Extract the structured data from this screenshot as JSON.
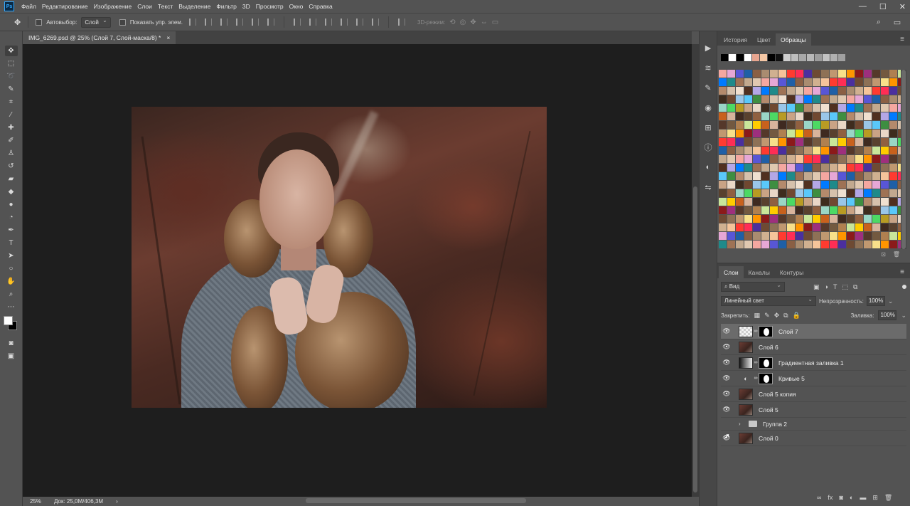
{
  "app": {
    "logo": "Ps"
  },
  "menu": [
    "Файл",
    "Редактирование",
    "Изображение",
    "Слои",
    "Текст",
    "Выделение",
    "Фильтр",
    "3D",
    "Просмотр",
    "Окно",
    "Справка"
  ],
  "window_controls": {
    "minimize": "—",
    "maximize": "☐",
    "close": "✕"
  },
  "options": {
    "autoselect_label": "Автовыбор:",
    "autoselect_value": "Слой",
    "show_controls_label": "Показать упр. элем.",
    "mode3d_label": "3D-режим:"
  },
  "document": {
    "tab_title": "IMG_6269.psd @ 25% (Слой 7, Слой-маска/8) *",
    "close": "×"
  },
  "status": {
    "zoom": "25%",
    "doc_size": "Док: 25,0M/406,3M"
  },
  "panels": {
    "top_tabs": [
      {
        "label": "История"
      },
      {
        "label": "Цвет"
      },
      {
        "label": "Образцы"
      }
    ],
    "active_top_tab": "Образцы",
    "layers_tabs": [
      {
        "label": "Слои"
      },
      {
        "label": "Каналы"
      },
      {
        "label": "Контуры"
      }
    ],
    "active_layers_tab": "Слои"
  },
  "layers_panel": {
    "filter_value": "⌕ Вид",
    "blend_mode": "Линейный свет",
    "opacity_label": "Непрозрачность:",
    "opacity_value": "100%",
    "lock_label": "Закрепить:",
    "fill_label": "Заливка:",
    "fill_value": "100%",
    "layers": [
      {
        "name": "Слой 7",
        "kind": "checker_mask",
        "visible": true,
        "selected": true
      },
      {
        "name": "Слой 6",
        "kind": "photo",
        "visible": true,
        "selected": false
      },
      {
        "name": "Градиентная заливка 1",
        "kind": "gradient_mask",
        "visible": true,
        "selected": false
      },
      {
        "name": "Кривые 5",
        "kind": "adjust_mask",
        "visible": true,
        "selected": false
      },
      {
        "name": "Слой 5 копия",
        "kind": "photo",
        "visible": true,
        "selected": false
      },
      {
        "name": "Слой 5",
        "kind": "photo",
        "visible": true,
        "selected": false
      },
      {
        "name": "Группа 2",
        "kind": "group",
        "visible": false,
        "selected": false
      },
      {
        "name": "Слой 0",
        "kind": "photo",
        "visible": true,
        "selected": false
      }
    ]
  },
  "colors": {
    "foreground": "#ffffff",
    "background": "#000000",
    "recent_swatches": [
      "#000000",
      "#ffffff",
      "#000000",
      "#ffffff",
      "#e7a58f",
      "#f5c7a5",
      "#000000",
      "#111111",
      "#cfcfcf",
      "#bdbdbd",
      "#a8a8a8",
      "#b8b8b8",
      "#9d9d9d",
      "#c2c2c2",
      "#b0b0b0",
      "#a0a0a0"
    ]
  }
}
